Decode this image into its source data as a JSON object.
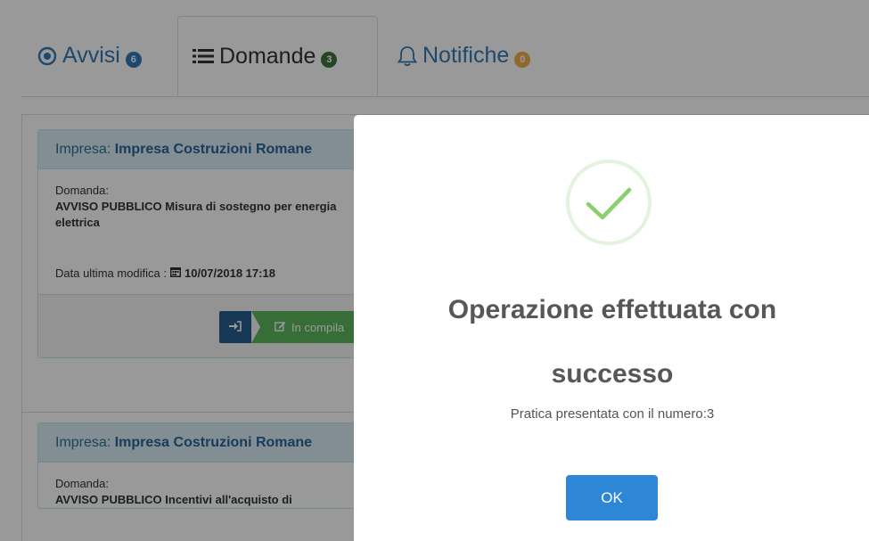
{
  "tabs": [
    {
      "label": "Avvisi",
      "badge": "6",
      "icon": "dot-circle-icon",
      "badge_color": "#337ab7"
    },
    {
      "label": "Domande",
      "badge": "3",
      "icon": "list-icon",
      "badge_color": "#3c763d"
    },
    {
      "label": "Notifiche",
      "badge": "0",
      "icon": "bell-icon",
      "badge_color": "#f0ad4e"
    }
  ],
  "cards": [
    {
      "impresa_label": "Impresa:",
      "impresa_name": "Impresa Costruzioni Romane",
      "domanda_label": "Domanda:",
      "domanda_text": "AVVISO PUBBLICO Misura di sostegno per energia elettrica",
      "date_label": "Data ultima modifica :",
      "date_value": "10/07/2018 17:18",
      "status_label": "In compila"
    },
    {
      "impresa_label": "Impresa:",
      "impresa_name": "Impresa Costruzioni Romane",
      "domanda_label": "Domanda:",
      "domanda_text": "AVVISO PUBBLICO Incentivi all'acquisto di"
    }
  ],
  "modal": {
    "icon": "success-check-icon",
    "title_line1": "Operazione effettuata con",
    "title_line2": "successo",
    "message": "Pratica presentata con il numero:3",
    "ok_label": "OK"
  },
  "colors": {
    "accent": "#337ab7",
    "success": "#5cb85c",
    "ok_button": "#2d86d6"
  }
}
